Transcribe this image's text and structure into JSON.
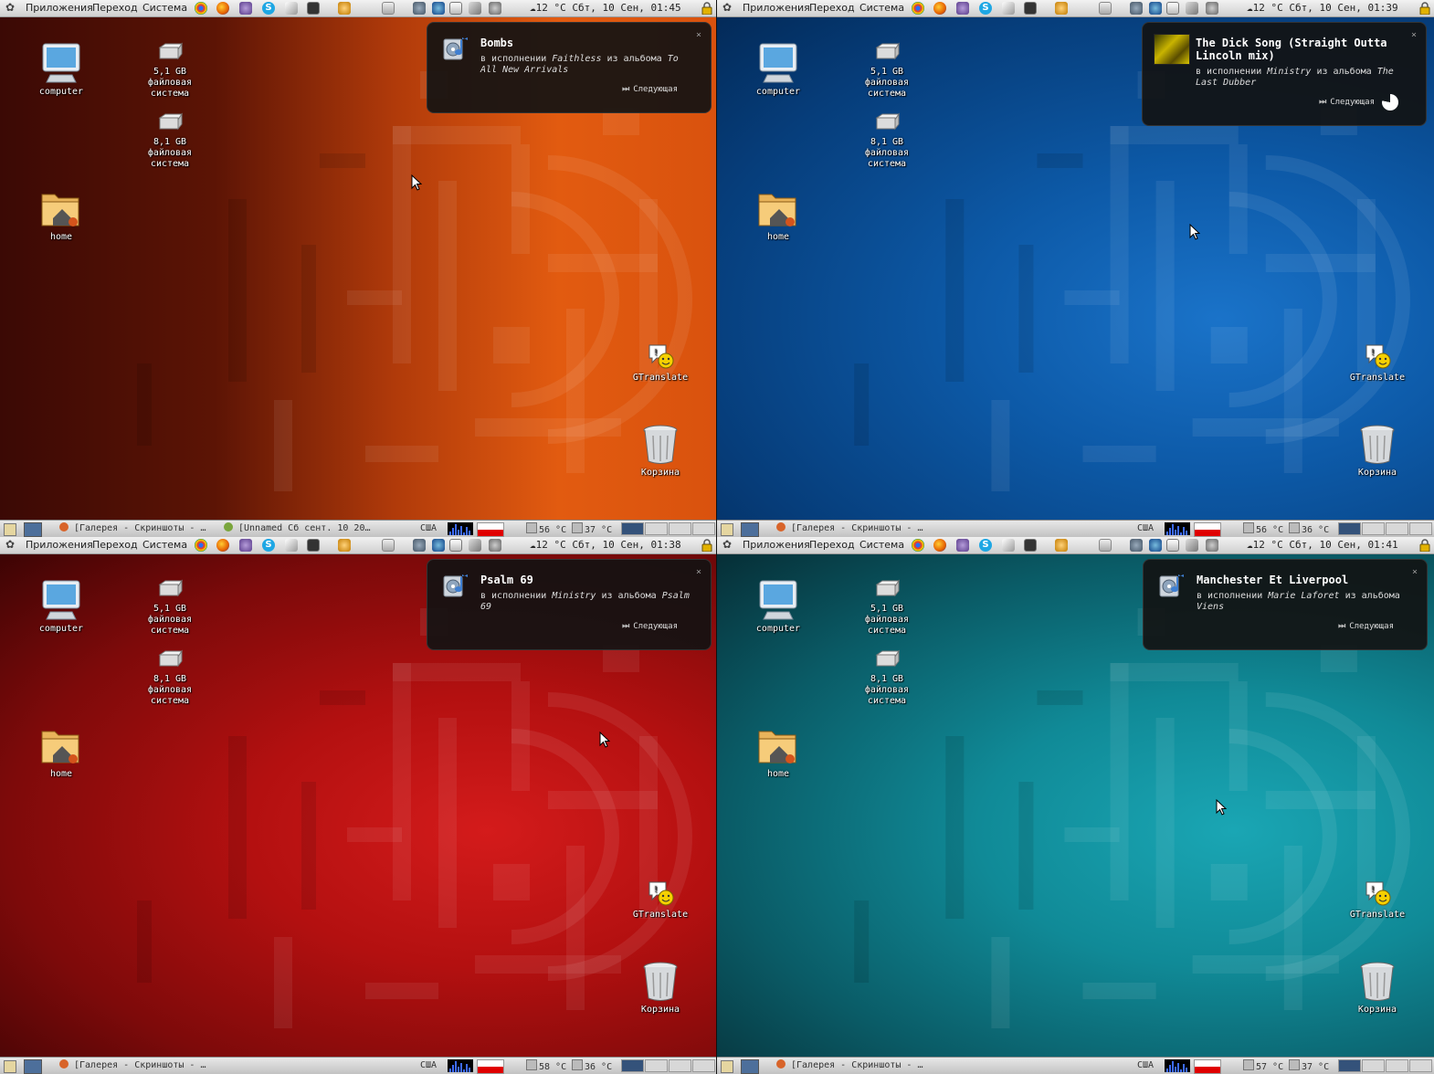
{
  "panel": {
    "menu_apps": "Приложения",
    "menu_places": "Переход",
    "menu_system": "Система",
    "weather": "12 °C",
    "kbd_layout": "США"
  },
  "desktop": {
    "computer": "computer",
    "fs1": "5,1 GB\nфайловая\nсистема",
    "fs2": "8,1 GB\nфайловая\nсистема",
    "home": "home",
    "gtranslate": "GTranslate",
    "trash": "Корзина"
  },
  "notification": {
    "by_prefix": "в исполнении",
    "album_prefix": "из альбома",
    "next_label": "Следующая",
    "close": "×"
  },
  "screens": [
    {
      "theme": "orange",
      "clock": "Сбт, 10 Сен, 01:45",
      "tasks": [
        "[Галерея - Скриншоты - …",
        "[Unnamed Сб сент. 10 20…"
      ],
      "temp_cpu": "56 °C",
      "temp_hdd": "37 °C",
      "song": {
        "title": "Bombs",
        "artist": "Faithless",
        "album": "To All New Arrivals"
      }
    },
    {
      "theme": "blue",
      "clock": "Сбт, 10 Сен, 01:39",
      "tasks": [
        "[Галерея - Скриншоты - …"
      ],
      "temp_cpu": "56 °C",
      "temp_hdd": "36 °C",
      "song": {
        "title": "The Dick Song (Straight Outta Lincoln mix)",
        "artist": "Ministry",
        "album": "The Last Dubber"
      }
    },
    {
      "theme": "red",
      "clock": "Сбт, 10 Сен, 01:38",
      "tasks": [
        "[Галерея - Скриншоты - …"
      ],
      "temp_cpu": "58 °C",
      "temp_hdd": "36 °C",
      "song": {
        "title": "Psalm 69",
        "artist": "Ministry",
        "album": "Psalm 69"
      }
    },
    {
      "theme": "teal",
      "clock": "Сбт, 10 Сен, 01:41",
      "tasks": [
        "[Галерея - Скриншоты - …"
      ],
      "temp_cpu": "57 °C",
      "temp_hdd": "37 °C",
      "song": {
        "title": "Manchester Et Liverpool",
        "artist": "Marie Laforet",
        "album": "Viens"
      }
    }
  ]
}
